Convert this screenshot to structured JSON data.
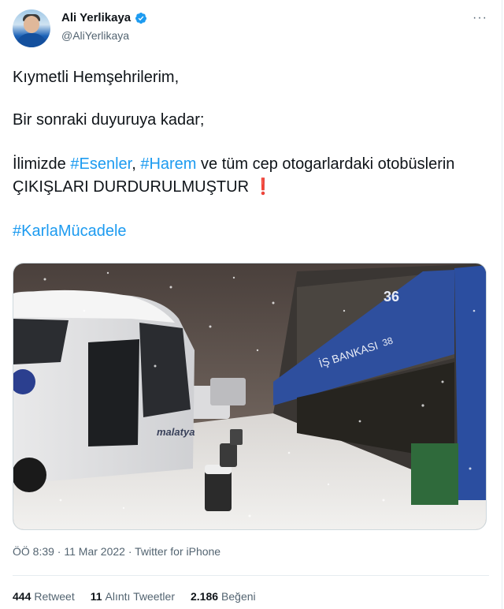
{
  "author": {
    "display_name": "Ali Yerlikaya",
    "handle": "@AliYerlikaya"
  },
  "more_icon": "···",
  "tweet": {
    "line1": "Kıymetli Hemşehrilerim,",
    "line2": "Bir sonraki duyuruya kadar;",
    "line3_pre": "İlimizde ",
    "hashtag1": "#Esenler",
    "sep": ", ",
    "hashtag2": "#Harem",
    "line3_post": " ve tüm cep otogarlardaki otobüslerin ÇIKIŞLARI DURDURULMUŞTUR",
    "emoji": "❗",
    "hashtag3": "#KarlaMücadele"
  },
  "media": {
    "bus_brand": "malatya",
    "shop_number": "36",
    "shop_sign": "İŞ BANKASI",
    "shop_number2": "38"
  },
  "meta": {
    "time": "ÖÖ 8:39",
    "date": "11 Mar 2022",
    "dot": " · ",
    "source": "Twitter for iPhone"
  },
  "stats": {
    "retweets": "444",
    "retweets_label": "Retweet",
    "quotes": "11",
    "quotes_label": "Alıntı Tweetler",
    "likes": "2.186",
    "likes_label": "Beğeni"
  },
  "colors": {
    "link": "#1d9bf0",
    "verified": "#1d9bf0",
    "secondary_text": "#536471"
  }
}
